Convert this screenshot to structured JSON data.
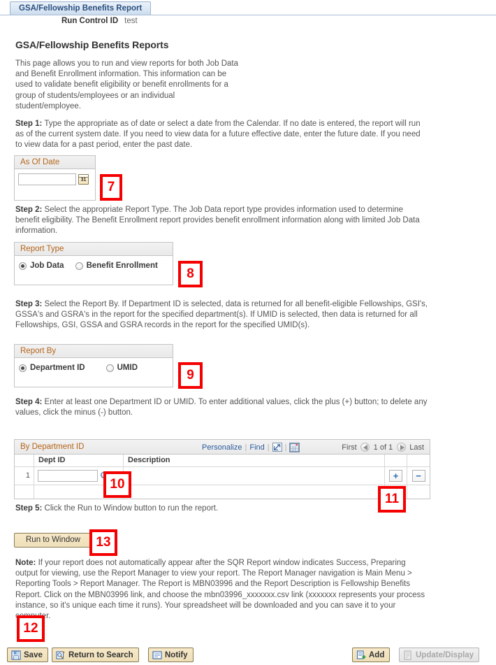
{
  "tab": {
    "label": "GSA/Fellowship Benefits Report"
  },
  "header": {
    "run_control_label": "Run Control ID",
    "run_control_value": "test",
    "page_title": "GSA/Fellowship Benefits Reports"
  },
  "intro": {
    "text": "This page allows you to run and view reports for both Job Data and Benefit Enrollment information. This information can be used to validate benefit eligibility or benefit enrollments for a group of students/employees or an individual student/employee."
  },
  "steps": {
    "step1_label": "Step 1:",
    "step1_text": " Type the appropriate as of date or select a date from the Calendar. If no date is entered, the report will run as of the current system date. If you need to view data for a future effective date, enter the future date. If you need to view data for a past period, enter the past date.",
    "step2_label": "Step 2:",
    "step2_text": " Select the appropriate Report Type. The Job Data report type provides information used to determine benefit eligibility. The Benefit Enrollment report provides benefit enrollment information along with limited Job Data information.",
    "step3_label": "Step 3:",
    "step3_text": " Select the Report By. If Department ID is selected, data is returned for all benefit-eligible Fellowships, GSI's, GSSA's and GSRA's in the report for the specified department(s). If UMID is selected, then data is returned for all Fellowships, GSI, GSSA and GSRA records in the report for the specified UMID(s).",
    "step4_label": "Step 4:",
    "step4_text": " Enter at least one Department ID or UMID. To enter additional values, click the plus (+) button; to delete any values, click the minus (-) button.",
    "step5_label": "Step 5:",
    "step5_text": " Click the Run to Window button to run the report."
  },
  "as_of_date": {
    "group_label": "As Of Date",
    "input_value": "",
    "input_placeholder": "",
    "calendar_icon": "calendar-icon"
  },
  "report_type": {
    "group_label": "Report Type",
    "options": [
      {
        "label": "Job Data",
        "selected": true
      },
      {
        "label": "Benefit Enrollment",
        "selected": false
      }
    ]
  },
  "report_by": {
    "group_label": "Report By",
    "options": [
      {
        "label": "Department ID",
        "selected": true
      },
      {
        "label": "UMID",
        "selected": false
      }
    ]
  },
  "grid": {
    "title": "By Department ID",
    "personalize_label": "Personalize",
    "find_label": "Find",
    "export_icon": "new-window-icon",
    "spreadsheet_icon": "grid-icon",
    "nav": {
      "first_label": "First",
      "prev_icon": "previous-arrow-icon",
      "counter": "1 of 1",
      "next_icon": "next-arrow-icon",
      "last_label": "Last"
    },
    "columns": [
      "",
      "Dept ID",
      "Description",
      "",
      ""
    ],
    "rows": [
      {
        "num": "1",
        "dept_id": "",
        "dept_id_placeholder": "",
        "lookup_icon": "lookup-magnifier-icon",
        "description": "",
        "add_label": "+",
        "delete_label": "−"
      }
    ]
  },
  "run_button": {
    "label": "Run to Window"
  },
  "note": {
    "label": "Note:",
    "text": " If your report does not automatically appear after the SQR Report window indicates Success, Preparing output for viewing, use the Report Manager to view your report. The Report Manager navigation is Main Menu > Reporting Tools > Report Manager. The Report is MBN03996 and the Report Description is Fellowship Benefits Report. Click on the MBN03996 link, and choose the mbn03996_xxxxxxx.csv link (xxxxxxx represents your process instance, so it's unique each time it runs). Your spreadsheet will be downloaded and you can save it to your computer."
  },
  "toolbar": {
    "save_label": "Save",
    "return_label": "Return to Search",
    "notify_label": "Notify",
    "add_label": "Add",
    "update_display_label": "Update/Display"
  },
  "callouts": {
    "c7": "7",
    "c8": "8",
    "c9": "9",
    "c10": "10",
    "c11": "11",
    "c12": "12",
    "c13": "13"
  },
  "colors": {
    "tab_text": "#2b4f7e",
    "group_label": "#b4651a",
    "link": "#2b5c9e",
    "callout_red": "#f40000",
    "button_gold": "#eedfb8"
  }
}
